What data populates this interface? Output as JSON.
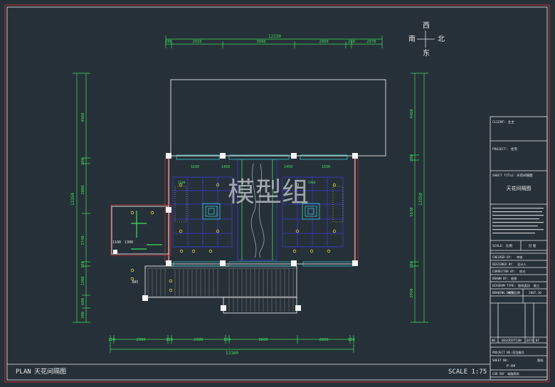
{
  "compass": {
    "north": "北",
    "south": "南",
    "east": "东",
    "west": "西"
  },
  "watermark": "模型组",
  "plan": {
    "label": "PLAN",
    "title": "天花间隔图",
    "scale": "SCALE 1:75"
  },
  "dims": {
    "top_total": "12230",
    "top_parts": [
      "200",
      "2910",
      "3980",
      "2860",
      "200",
      "2070"
    ],
    "bottom_total": "13160",
    "bottom_parts": [
      "150",
      "2900",
      "150",
      "2980",
      "150",
      "3800",
      "2860",
      "150"
    ],
    "left_total": "13350",
    "left_parts": [
      "4960",
      "200",
      "2000",
      "2740",
      "150",
      "1200",
      "600",
      "300"
    ],
    "right_total": "13350",
    "right_parts": [
      "4460",
      "200",
      "5630",
      "150",
      "2950"
    ],
    "inner": [
      "1630",
      "1450",
      "1450",
      "1630",
      "1100",
      "1900",
      "1100",
      "1300",
      "885"
    ]
  },
  "title_block": {
    "client_label": "CLIENT:",
    "client_value": "业主",
    "project_label": "PROJECT:",
    "project_value": "住宅",
    "sheet_title_label": "SHEET TITLE:",
    "sheet_title_value": "天花间隔图",
    "sheet_title_big": "天花间隔图",
    "scale_label": "SCALE:",
    "scale_value": "比例",
    "scale_extra": "见 图",
    "rows": [
      {
        "label": "CHECKED BY:",
        "value": "审核"
      },
      {
        "label": "DESIGNED BY:",
        "value": "设计人"
      },
      {
        "label": "CORRECTOR BY:",
        "value": "校对"
      },
      {
        "label": "DRAWN BY:",
        "value": "绘图"
      },
      {
        "label": "DIAGRAM TYPE:",
        "value": "图纸类别",
        "extra": "施工"
      },
      {
        "label": "DRAWING DATE:",
        "value": "绘图日期",
        "extra": "2007.10"
      }
    ],
    "revision_header": [
      "NO.",
      "DESCRIPTION",
      "DATE",
      "BY"
    ],
    "project_no_label": "PROJECT NO:",
    "project_no_value": "项目编号",
    "sheet_no_label": "SHEET NO:",
    "sheet_no_value": "P-04",
    "sheet_no_extra": "图纸",
    "cad_ref_label": "CAD REF",
    "cad_ref_value": "电脑资料"
  },
  "colors": {
    "background": "#263038",
    "frame": "#c0302e",
    "outline": "#e8e8e8",
    "dimension": "#3ee05a",
    "grid": "#3a3ad8",
    "fixture": "#d8d040"
  }
}
